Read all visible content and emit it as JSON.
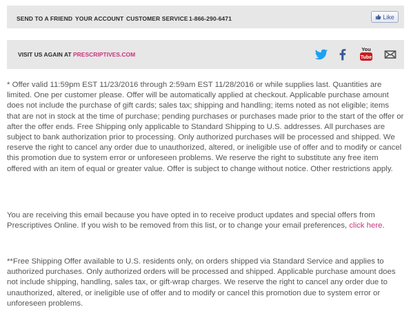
{
  "header": {
    "nav": [
      {
        "label": "SEND TO A FRIEND"
      },
      {
        "label": "YOUR ACCOUNT"
      },
      {
        "label": "CUSTOMER SERVICE"
      },
      {
        "label": "1-866-290-6471"
      }
    ],
    "like_label": "Like"
  },
  "visit": {
    "prefix": "VISIT US AGAIN AT",
    "site": "PRESCRIPTIVES.COM",
    "social_icons": [
      "twitter-icon",
      "facebook-icon",
      "youtube-icon",
      "email-icon"
    ],
    "youtube_text": "You Tube"
  },
  "colors": {
    "bar_bg": "#e7e7e7",
    "link_pink": "#c8357c",
    "twitter_blue": "#1da1f2",
    "facebook_blue": "#3b5998",
    "youtube_red": "#cc181e",
    "text_gray": "#555555"
  },
  "disclaimer": {
    "offer": "* Offer valid 11:59pm EST 11/23/2016 through 2:59am EST 11/28/2016 or while supplies last. Quantities are limited. One per customer please. Offer will be automatically applied at checkout. Applicable purchase amount does not include the purchase of gift cards; sales tax; shipping and handling; items noted as not eligible; items that are not in stock at the time of purchase; pending purchases or purchases made prior to the start of the offer or after the offer ends. Free Shipping only applicable to Standard Shipping to U.S. addresses. All purchases are subject to bank authorization prior to processing. Only authorized purchases will be processed and shipped. We reserve the right to cancel any order due to unauthorized, altered, or ineligible use of offer and to modify or cancel this promotion due to system error or unforeseen problems. We reserve the right to substitute any free item offered with an item of equal or greater value. Offer is subject to change without notice. Other restrictions apply.",
    "optin_text": "You are receiving this email because you have opted in to receive product updates and special offers from Prescriptives Online. If you wish to be removed from this list, or to change your email preferences, ",
    "optin_link": "click here",
    "optin_end": ".",
    "shipping": "**Free Shipping Offer available to U.S. residents only, on orders shipped via Standard Service and applies to authorized purchases. Only authorized orders will be processed and shipped. Applicable purchase amount does not include shipping, handling, sales tax, or gift-wrap charges. We reserve the right to cancel any order due to unauthorized, altered, or ineligible use of offer and to modify or cancel this promotion due to system error or unforeseen problems."
  }
}
